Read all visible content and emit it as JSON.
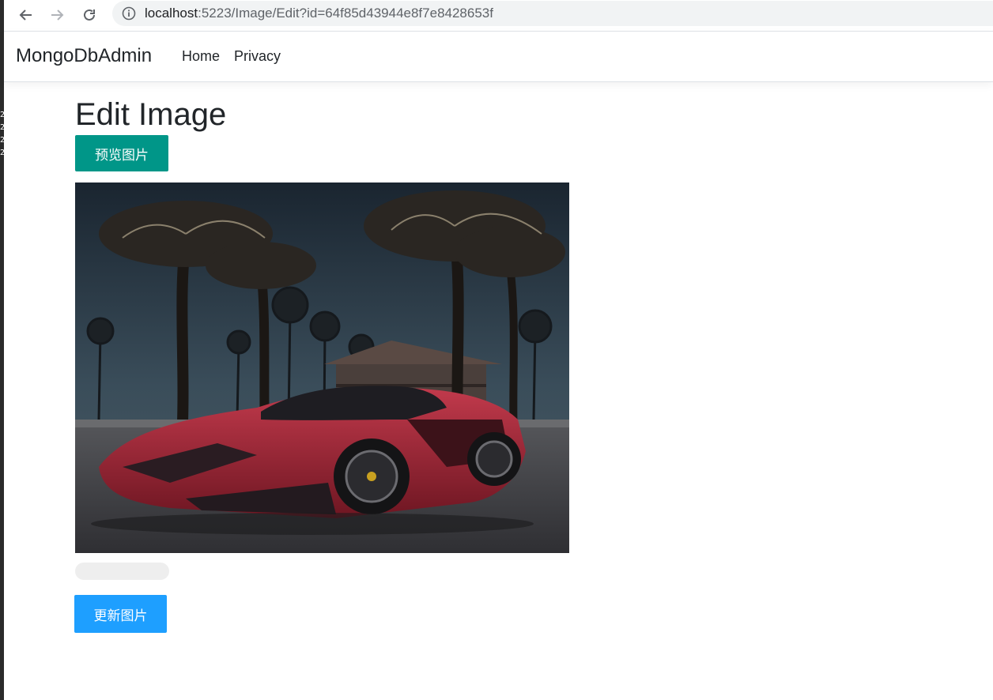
{
  "browser": {
    "url_host": "localhost",
    "url_path": ":5223/Image/Edit?id=64f85d43944e8f7e8428653f"
  },
  "side_marks": [
    "2",
    "2",
    "2",
    "2"
  ],
  "navbar": {
    "brand": "MongoDbAdmin",
    "links": [
      "Home",
      "Privacy"
    ]
  },
  "main": {
    "title": "Edit Image",
    "preview_button": "预览图片",
    "update_button": "更新图片",
    "upload_progress": 0
  },
  "colors": {
    "preview_button": "#009688",
    "update_button": "#1e9fff",
    "progress_track": "#eeeeee"
  }
}
